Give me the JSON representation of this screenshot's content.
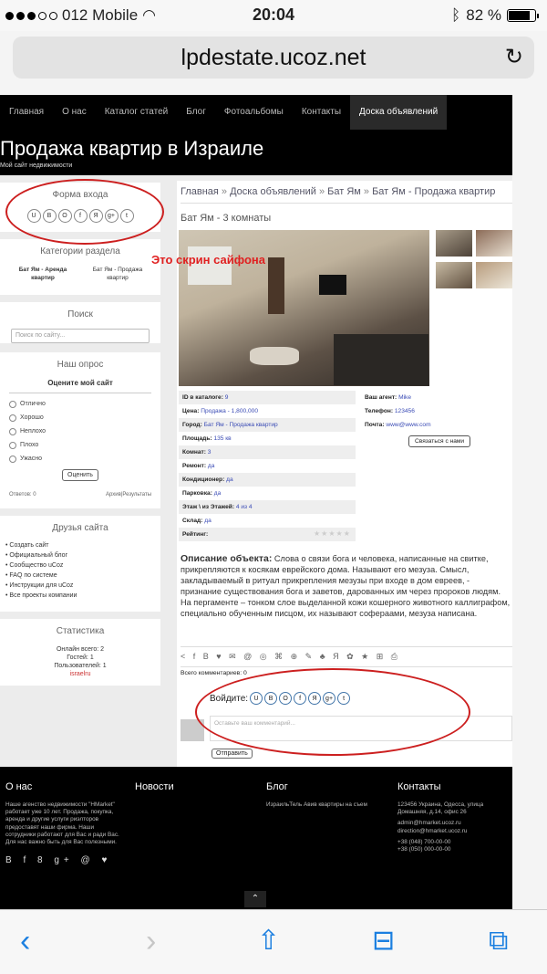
{
  "status": {
    "carrier": "012 Mobile",
    "time": "20:04",
    "battery": "82 %"
  },
  "url": "lpdestate.ucoz.net",
  "nav": [
    "Главная",
    "О нас",
    "Каталог статей",
    "Блог",
    "Фотоальбомы",
    "Контакты",
    "Доска объявлений"
  ],
  "site": {
    "title": "Продажа квартир в Израиле",
    "subtitle": "Мой сайт недвижимости"
  },
  "login": {
    "title": "Форма входа",
    "icons": [
      "U",
      "B",
      "O",
      "f",
      "Я",
      "g+",
      "t"
    ]
  },
  "categories": {
    "title": "Категории раздела",
    "a": "Бат Ям - Аренда квартир",
    "b": "Бат Ям - Продажа квартир"
  },
  "search": {
    "title": "Поиск",
    "placeholder": "Поиск по сайту..."
  },
  "poll": {
    "title": "Наш опрос",
    "question": "Оцените мой сайт",
    "options": [
      "Отлично",
      "Хорошо",
      "Неплохо",
      "Плохо",
      "Ужасно"
    ],
    "vote": "Оценить",
    "answers": "Ответов: 0",
    "archive": "Архив|Результаты"
  },
  "friends": {
    "title": "Друзья сайта",
    "items": [
      "Создать сайт",
      "Официальный блог",
      "Сообщество uCoz",
      "FAQ по системе",
      "Инструкции для uCoz",
      "Все проекты компании"
    ]
  },
  "stats": {
    "title": "Статистика",
    "online": "Онлайн всего: 2",
    "guests": "Гостей: 1",
    "users": "Пользователей: 1",
    "user": "israelru"
  },
  "breadcrumb": {
    "home": "Главная",
    "sep": " » ",
    "board": "Доска объявлений",
    "city": "Бат Ям",
    "cat": "Бат Ям - Продажа квартир"
  },
  "ad": {
    "title": "Бат Ям - 3 комнаты",
    "specs": [
      {
        "k": "ID в каталоге:",
        "v": "9"
      },
      {
        "k": "Цена:",
        "v": "Продажа - 1,800,000"
      },
      {
        "k": "Город:",
        "v": "Бат Ям - Продажа квартир"
      },
      {
        "k": "Площадь:",
        "v": "135 кв"
      },
      {
        "k": "Комнат:",
        "v": "3"
      },
      {
        "k": "Ремонт:",
        "v": "да"
      },
      {
        "k": "Кондиционер:",
        "v": "да"
      },
      {
        "k": "Парковка:",
        "v": "да"
      },
      {
        "k": "Этаж \\ из Этажей:",
        "v": "4 из 4"
      },
      {
        "k": "Склад:",
        "v": "да"
      },
      {
        "k": "Рейтинг:",
        "v": ""
      }
    ],
    "agent": {
      "agent_label": "Ваш агент:",
      "agent": "Mike",
      "phone_label": "Телефон:",
      "phone": "123456",
      "mail_label": "Почта:",
      "mail": "www@www.com",
      "contact": "Связаться с нами"
    },
    "desc_title": "Описание объекта:",
    "desc": "Слова о связи бога и человека, написанные на свитке, прикрепляются к косякам еврейского дома. Называют его мезуза. Смысл, закладываемый в ритуал прикрепления мезузы при входе в дом евреев, - признание существования бога и заветов, дарованных им через пророков людям. На пергаменте – тонком слое выделанной кожи кошерного животного каллиграфом, специально обученным писцом, их называют софераами, мезуза написана."
  },
  "share": "< f B ♥ ✉ @ ◎ ⌘ ⊕ ✎ ♣ Я ✿ ★ ⊞ ⎙",
  "comments": {
    "count": "Всего комментариев: 0",
    "login_label": "Войдите:",
    "placeholder": "Оставьте ваш комментарий...",
    "send": "Отправить"
  },
  "annotation": "Это скрин сайфона",
  "footer": {
    "about_t": "О нас",
    "about": "Наше агенство недвижимости \"HMarket\" работает уже 10 лет. Продажа, покупка, аренда и другие услуги риэлторов предоставят наши фирма. Наши сотрудники работают для Вас и ради Вас. Для нас важно быть для Вас полезными.",
    "news_t": "Новости",
    "blog_t": "Блог",
    "blog_item": "ИзраильТель Авив квартиры на съем",
    "contacts_t": "Контакты",
    "addr": "123456 Украина, Одесса, улица Домашняя, д.14, офис 26",
    "mail": "admin@hmarket.ucoz.ru",
    "mail2": "direction@hmarket.ucoz.ru",
    "ph1": "+38 (048) 700-00-00",
    "ph2": "+38 (050) 000-00-00",
    "social": "B f 8 g+ @ ♥"
  }
}
